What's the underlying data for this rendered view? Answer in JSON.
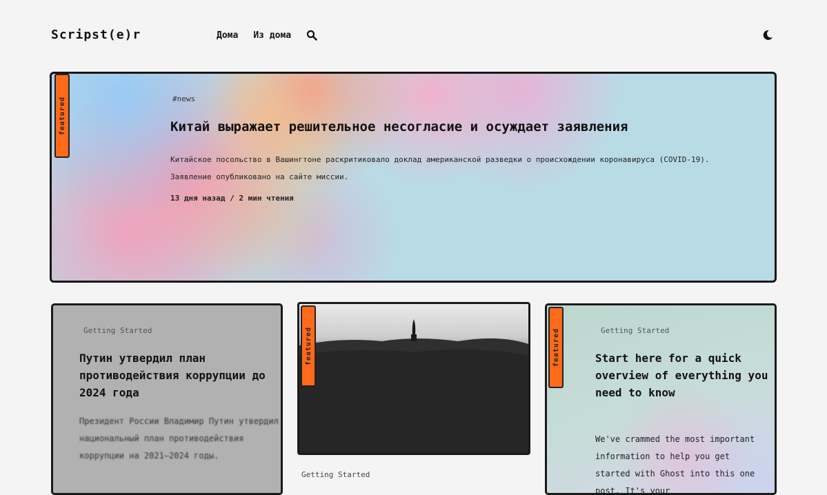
{
  "header": {
    "logo": "Scripst(e)r",
    "nav": [
      "Дома",
      "Из дома"
    ],
    "search_icon": "search-icon",
    "theme_icon": "moon-icon"
  },
  "hero": {
    "badge": "featured",
    "tag": "#news",
    "title": "Китай выражает решительное несогласие и осуждает заявления",
    "excerpt": "Китайское посольство в Вашингтоне раскритиковало доклад американской разведки о происхождении коронавируса (COVID-19). Заявление опубликовано на сайте миссии.",
    "meta": "13 дня назад / 2 мин чтения"
  },
  "cards": [
    {
      "tag": "Getting Started",
      "title": "Путин утвердил план противодействия коррупции до 2024 года",
      "excerpt": "Президент России Владимир Путин утвердил национальный план противодействия коррупции на 2021–2024 годы."
    },
    {
      "badge": "featured",
      "tag": "Getting Started"
    },
    {
      "badge": "featured",
      "tag": "Getting Started",
      "title": "Start here for a quick overview of everything you need to know",
      "excerpt": "We've crammed the most important information to help you get started with Ghost into this one post. It's your"
    }
  ],
  "colors": {
    "badge": "#ff6a1a",
    "hero_bg": "#b9dbe6",
    "card1_bg": "#b1b1b1",
    "card3_bg": "#c6dcd8"
  }
}
